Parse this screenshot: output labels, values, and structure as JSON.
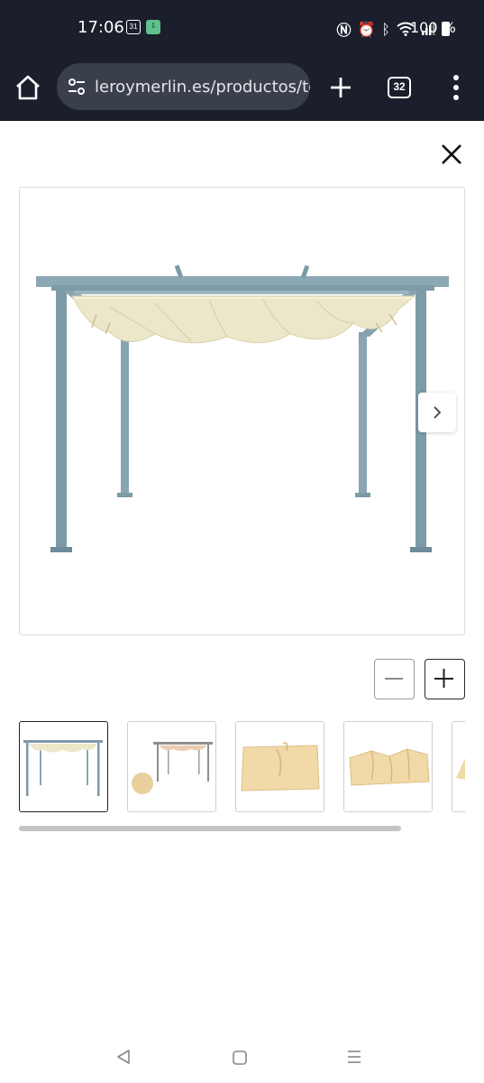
{
  "status_bar": {
    "time": "17:06",
    "calendar_badge": "31",
    "battery_text": "100 %",
    "icons": [
      "calendar-icon",
      "download-icon",
      "nfc-icon",
      "alarm-icon",
      "bluetooth-icon",
      "wifi-icon",
      "signal-icon",
      "battery-icon"
    ]
  },
  "browser": {
    "url": "leroymerlin.es/productos/tc",
    "tab_count": "32",
    "icons": [
      "home-icon",
      "site-settings-icon",
      "plus-icon",
      "more-vert-icon"
    ]
  },
  "viewer": {
    "close_icon": "close-icon",
    "next_icon": "chevron-right-icon",
    "zoom_out_label": "−",
    "zoom_in_label": "+",
    "thumbnails": [
      {
        "name": "pergola-blue-frame",
        "active": true
      },
      {
        "name": "pergola-gray-frame-with-swatch",
        "active": false
      },
      {
        "name": "canopy-folded",
        "active": false
      },
      {
        "name": "canopy-rolled",
        "active": false
      },
      {
        "name": "canopy-partial",
        "active": false
      }
    ]
  },
  "colors": {
    "status_bg": "#1b1f2b",
    "frame_blue": "#7d9aa7",
    "canopy_cream": "#ece7c9",
    "fabric_beige": "#f1d9a8"
  },
  "nav_bar": {
    "icons": [
      "back-icon",
      "home-nav-icon",
      "recents-icon"
    ]
  }
}
